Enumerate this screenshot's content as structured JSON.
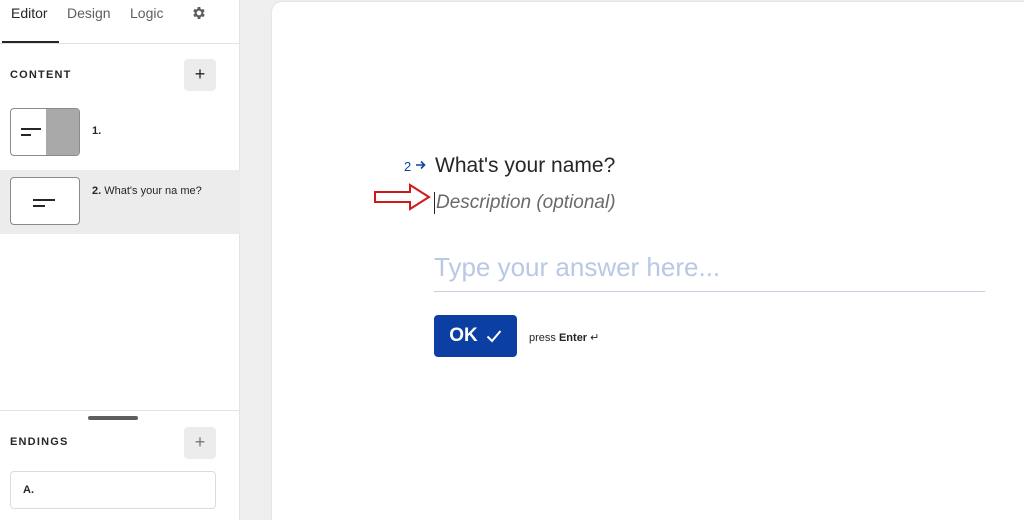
{
  "tabs": {
    "editor": "Editor",
    "design": "Design",
    "logic": "Logic",
    "settings_icon": "gear-icon"
  },
  "content": {
    "title": "CONTENT",
    "add_label": "+",
    "items": [
      {
        "number": "1.",
        "text": ""
      },
      {
        "number": "2.",
        "text": "What's your na me?"
      }
    ]
  },
  "endings": {
    "title": "ENDINGS",
    "add_label": "+",
    "items": [
      {
        "label": "A."
      }
    ]
  },
  "question": {
    "number": "2",
    "title": "What's your name?",
    "description_placeholder": "Description (optional)",
    "answer_placeholder": "Type your answer here...",
    "ok_label": "OK",
    "hint_prefix": "press",
    "hint_key": "Enter",
    "hint_symbol": "↵"
  },
  "colors": {
    "accent": "#0b3fa3",
    "annotation_arrow": "#d0191b"
  }
}
